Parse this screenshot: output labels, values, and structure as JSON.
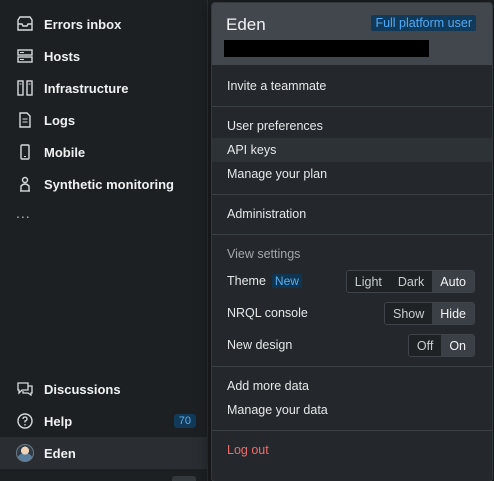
{
  "sidebar": {
    "items": [
      {
        "label": "Errors inbox",
        "icon": "inbox-icon"
      },
      {
        "label": "Hosts",
        "icon": "server-icon"
      },
      {
        "label": "Infrastructure",
        "icon": "infrastructure-icon"
      },
      {
        "label": "Logs",
        "icon": "document-icon"
      },
      {
        "label": "Mobile",
        "icon": "mobile-icon"
      },
      {
        "label": "Synthetic monitoring",
        "icon": "robot-icon"
      }
    ],
    "more": "...",
    "bottom": {
      "discussions": "Discussions",
      "help": "Help",
      "help_count": "70",
      "user": "Eden"
    }
  },
  "account": {
    "name": "Eden",
    "role": "Full platform user",
    "invite": "Invite a teammate",
    "user_preferences": "User preferences",
    "api_keys": "API keys",
    "manage_plan": "Manage your plan",
    "administration": "Administration",
    "view_settings": "View settings",
    "theme": {
      "label": "Theme",
      "tag": "New",
      "options": [
        "Light",
        "Dark",
        "Auto"
      ],
      "selected": "Auto"
    },
    "nrql": {
      "label": "NRQL console",
      "options": [
        "Show",
        "Hide"
      ],
      "selected": "Hide"
    },
    "new_design": {
      "label": "New design",
      "options": [
        "Off",
        "On"
      ],
      "selected": "On"
    },
    "add_data": "Add more data",
    "manage_data": "Manage your data",
    "logout": "Log out"
  },
  "colors": {
    "accent": "#52a9f5",
    "danger": "#f06b6b",
    "background": "#1b1e21",
    "panel": "#24282c"
  }
}
